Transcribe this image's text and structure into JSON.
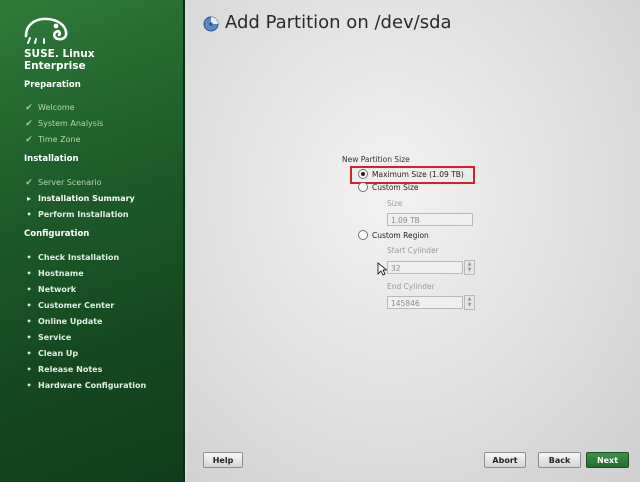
{
  "brand": {
    "line1": "SUSE. Linux",
    "line2": "Enterprise"
  },
  "sidebar": {
    "preparation": {
      "title": "Preparation",
      "items": [
        {
          "label": "Welcome",
          "state": "done"
        },
        {
          "label": "System Analysis",
          "state": "done"
        },
        {
          "label": "Time Zone",
          "state": "done"
        }
      ]
    },
    "installation": {
      "title": "Installation",
      "items": [
        {
          "label": "Server Scenario",
          "state": "done"
        },
        {
          "label": "Installation Summary",
          "state": "current"
        },
        {
          "label": "Perform Installation",
          "state": "pending"
        }
      ]
    },
    "configuration": {
      "title": "Configuration",
      "items": [
        {
          "label": "Check Installation",
          "state": "pending"
        },
        {
          "label": "Hostname",
          "state": "pending"
        },
        {
          "label": "Network",
          "state": "pending"
        },
        {
          "label": "Customer Center",
          "state": "pending"
        },
        {
          "label": "Online Update",
          "state": "pending"
        },
        {
          "label": "Service",
          "state": "pending"
        },
        {
          "label": "Clean Up",
          "state": "pending"
        },
        {
          "label": "Release Notes",
          "state": "pending"
        },
        {
          "label": "Hardware Configuration",
          "state": "pending"
        }
      ]
    },
    "marks": {
      "done": "✔",
      "current": "▸",
      "pending": "•"
    }
  },
  "main": {
    "title": "Add Partition on /dev/sda",
    "group_label": "New Partition Size",
    "options": {
      "max_size": {
        "label": "Maximum Size (1.09 TB)",
        "selected": true
      },
      "custom_size": {
        "label": "Custom Size",
        "selected": false
      },
      "custom_region": {
        "label": "Custom Region",
        "selected": false
      }
    },
    "size": {
      "label": "Size",
      "value": "1.09 TB"
    },
    "start_cylinder": {
      "label": "Start Cylinder",
      "value": "32"
    },
    "end_cylinder": {
      "label": "End Cylinder",
      "value": "145846"
    }
  },
  "buttons": {
    "help": "Help",
    "abort": "Abort",
    "back": "Back",
    "next": "Next"
  },
  "colors": {
    "accent": "#246b2e",
    "highlight": "#d8202a",
    "sidebar": "#1f5e2a"
  }
}
